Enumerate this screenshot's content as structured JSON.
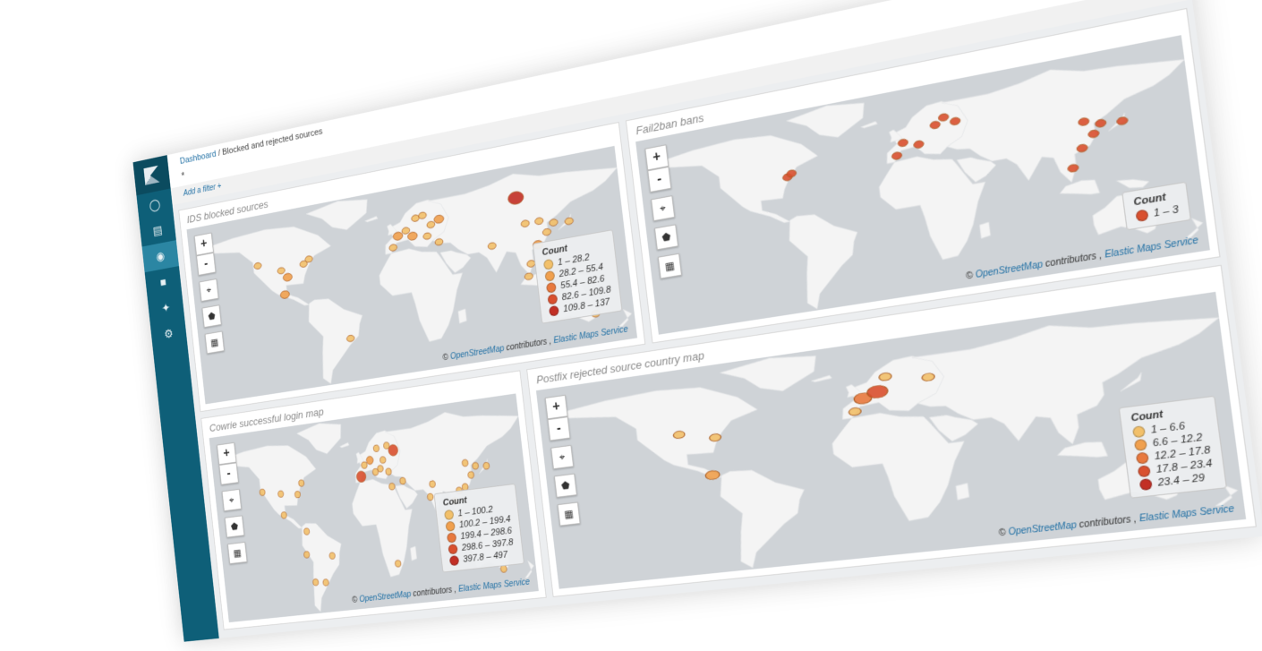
{
  "breadcrumb": {
    "root": "Dashboard",
    "separator": "/",
    "current": "Blocked and rejected sources"
  },
  "query": "*",
  "filter": {
    "add_label": "Add a filter",
    "add_icon": "+"
  },
  "sidebar": {
    "items": [
      "compass-icon",
      "bar-chart-icon",
      "dashboard-icon",
      "timelion-icon",
      "wrench-icon",
      "gear-icon"
    ]
  },
  "map_controls": {
    "zoom_in": "+",
    "zoom_out": "-"
  },
  "attribution": {
    "copy": "©",
    "osm": "OpenStreetMap",
    "contributors": "contributors ,",
    "ems": "Elastic Maps Service"
  },
  "colors": {
    "sidebar": "#0e5f78",
    "map_bg": "#cfd3d7",
    "land": "#f4f4f4",
    "accent": "#1f6fa4"
  },
  "panels": [
    {
      "title": "IDS blocked sources",
      "legend": {
        "title": "Count",
        "ranges": [
          "1 – 28.2",
          "28.2 – 55.4",
          "55.4 – 82.6",
          "82.6 – 109.8",
          "109.8 – 137"
        ],
        "colors": [
          "#f2c06a",
          "#f0a04e",
          "#e8793e",
          "#d9502f",
          "#c22f25"
        ]
      },
      "markers": [
        {
          "lon": -120,
          "lat": 45,
          "c": 0
        },
        {
          "lon": -100,
          "lat": 38,
          "c": 0
        },
        {
          "lon": -95,
          "lat": 32,
          "c": 1
        },
        {
          "lon": -80,
          "lat": 40,
          "c": 0
        },
        {
          "lon": -75,
          "lat": 43,
          "c": 0
        },
        {
          "lon": -99,
          "lat": 19,
          "c": 1
        },
        {
          "lon": -47,
          "lat": -23,
          "c": 0
        },
        {
          "lon": -3,
          "lat": 40,
          "c": 0
        },
        {
          "lon": 2,
          "lat": 48,
          "c": 1
        },
        {
          "lon": 9,
          "lat": 51,
          "c": 0
        },
        {
          "lon": 18,
          "lat": 59,
          "c": 0
        },
        {
          "lon": 24,
          "lat": 60,
          "c": 0
        },
        {
          "lon": 30,
          "lat": 52,
          "c": 0
        },
        {
          "lon": 37,
          "lat": 55,
          "c": 1
        },
        {
          "lon": 26,
          "lat": 44,
          "c": 0
        },
        {
          "lon": 14,
          "lat": 46,
          "c": 1
        },
        {
          "lon": 35,
          "lat": 38,
          "c": 0
        },
        {
          "lon": 77,
          "lat": 28,
          "c": 0
        },
        {
          "lon": 105,
          "lat": 40,
          "c": 0
        },
        {
          "lon": 116,
          "lat": 40,
          "c": 0
        },
        {
          "lon": 121,
          "lat": 31,
          "c": 0
        },
        {
          "lon": 113,
          "lat": 23,
          "c": 1
        },
        {
          "lon": 127,
          "lat": 37,
          "c": 0
        },
        {
          "lon": 139,
          "lat": 36,
          "c": 0
        },
        {
          "lon": 106,
          "lat": 10,
          "c": 0
        },
        {
          "lon": 103,
          "lat": 1,
          "c": 0
        },
        {
          "lon": 100,
          "lat": 60,
          "c": 4
        },
        {
          "lon": 151,
          "lat": -34,
          "c": 0
        }
      ]
    },
    {
      "title": "Fail2ban bans",
      "legend": {
        "title": "Count",
        "ranges": [
          "1 – 3"
        ],
        "colors": [
          "#d9502f"
        ]
      },
      "markers": [
        {
          "lon": -77,
          "lat": 39,
          "c": 0
        },
        {
          "lon": -74,
          "lat": 41,
          "c": 0
        },
        {
          "lon": -3,
          "lat": 40,
          "c": 0
        },
        {
          "lon": 12,
          "lat": 45,
          "c": 0
        },
        {
          "lon": 2,
          "lat": 48,
          "c": 0
        },
        {
          "lon": 24,
          "lat": 56,
          "c": 0
        },
        {
          "lon": 37,
          "lat": 56,
          "c": 0
        },
        {
          "lon": 30,
          "lat": 60,
          "c": 0
        },
        {
          "lon": 116,
          "lat": 40,
          "c": 0
        },
        {
          "lon": 121,
          "lat": 31,
          "c": 0
        },
        {
          "lon": 126,
          "lat": 37,
          "c": 0
        },
        {
          "lon": 139,
          "lat": 36,
          "c": 0
        },
        {
          "lon": 113,
          "lat": 23,
          "c": 0
        },
        {
          "lon": 106,
          "lat": 11,
          "c": 0
        }
      ]
    },
    {
      "title": "Cowrie successful login map",
      "legend": {
        "title": "Count",
        "ranges": [
          "1 – 100.2",
          "100.2 – 199.4",
          "199.4 – 298.6",
          "298.6 – 397.8",
          "397.8 – 497"
        ],
        "colors": [
          "#f2c06a",
          "#f0a04e",
          "#e8793e",
          "#d9502f",
          "#c22f25"
        ]
      },
      "markers": [
        {
          "lon": -122,
          "lat": 38,
          "c": 0
        },
        {
          "lon": -100,
          "lat": 35,
          "c": 0
        },
        {
          "lon": -80,
          "lat": 33,
          "c": 0
        },
        {
          "lon": -74,
          "lat": 41,
          "c": 0
        },
        {
          "lon": -99,
          "lat": 19,
          "c": 0
        },
        {
          "lon": -74,
          "lat": 5,
          "c": 0
        },
        {
          "lon": -77,
          "lat": -12,
          "c": 0
        },
        {
          "lon": -47,
          "lat": -15,
          "c": 0
        },
        {
          "lon": -58,
          "lat": -34,
          "c": 0
        },
        {
          "lon": -70,
          "lat": -33,
          "c": 0
        },
        {
          "lon": -3,
          "lat": 40,
          "c": 3
        },
        {
          "lon": 2,
          "lat": 48,
          "c": 0
        },
        {
          "lon": 9,
          "lat": 51,
          "c": 1
        },
        {
          "lon": 18,
          "lat": 59,
          "c": 0
        },
        {
          "lon": 30,
          "lat": 60,
          "c": 0
        },
        {
          "lon": 37,
          "lat": 56,
          "c": 3
        },
        {
          "lon": 24,
          "lat": 50,
          "c": 0
        },
        {
          "lon": 20,
          "lat": 44,
          "c": 0
        },
        {
          "lon": 14,
          "lat": 42,
          "c": 0
        },
        {
          "lon": 29,
          "lat": 41,
          "c": 0
        },
        {
          "lon": 31,
          "lat": 30,
          "c": 0
        },
        {
          "lon": 44,
          "lat": 33,
          "c": 0
        },
        {
          "lon": 77,
          "lat": 28,
          "c": 0
        },
        {
          "lon": 73,
          "lat": 19,
          "c": 0
        },
        {
          "lon": 100,
          "lat": 14,
          "c": 0
        },
        {
          "lon": 106,
          "lat": 21,
          "c": 0
        },
        {
          "lon": 113,
          "lat": 23,
          "c": 0
        },
        {
          "lon": 121,
          "lat": 31,
          "c": 0
        },
        {
          "lon": 116,
          "lat": 40,
          "c": 0
        },
        {
          "lon": 127,
          "lat": 37,
          "c": 0
        },
        {
          "lon": 139,
          "lat": 36,
          "c": 0
        },
        {
          "lon": 103,
          "lat": 1,
          "c": 0
        },
        {
          "lon": 145,
          "lat": -38,
          "c": 0
        },
        {
          "lon": 28,
          "lat": -26,
          "c": 0
        }
      ]
    },
    {
      "title": "Postfix rejected source country map",
      "legend": {
        "title": "Count",
        "ranges": [
          "1 – 6.6",
          "6.6 – 12.2",
          "12.2 – 17.8",
          "17.8 – 23.4",
          "23.4 – 29"
        ],
        "colors": [
          "#f2c06a",
          "#f0a04e",
          "#e8793e",
          "#d9502f",
          "#c22f25"
        ]
      },
      "markers": [
        {
          "lon": -100,
          "lat": 40,
          "c": 0
        },
        {
          "lon": -80,
          "lat": 35,
          "c": 0
        },
        {
          "lon": -84,
          "lat": 10,
          "c": 1
        },
        {
          "lon": -3,
          "lat": 40,
          "c": 0
        },
        {
          "lon": 2,
          "lat": 48,
          "c": 2
        },
        {
          "lon": 10,
          "lat": 51,
          "c": 3
        },
        {
          "lon": 15,
          "lat": 60,
          "c": 0
        },
        {
          "lon": 37,
          "lat": 56,
          "c": 0
        }
      ]
    }
  ]
}
